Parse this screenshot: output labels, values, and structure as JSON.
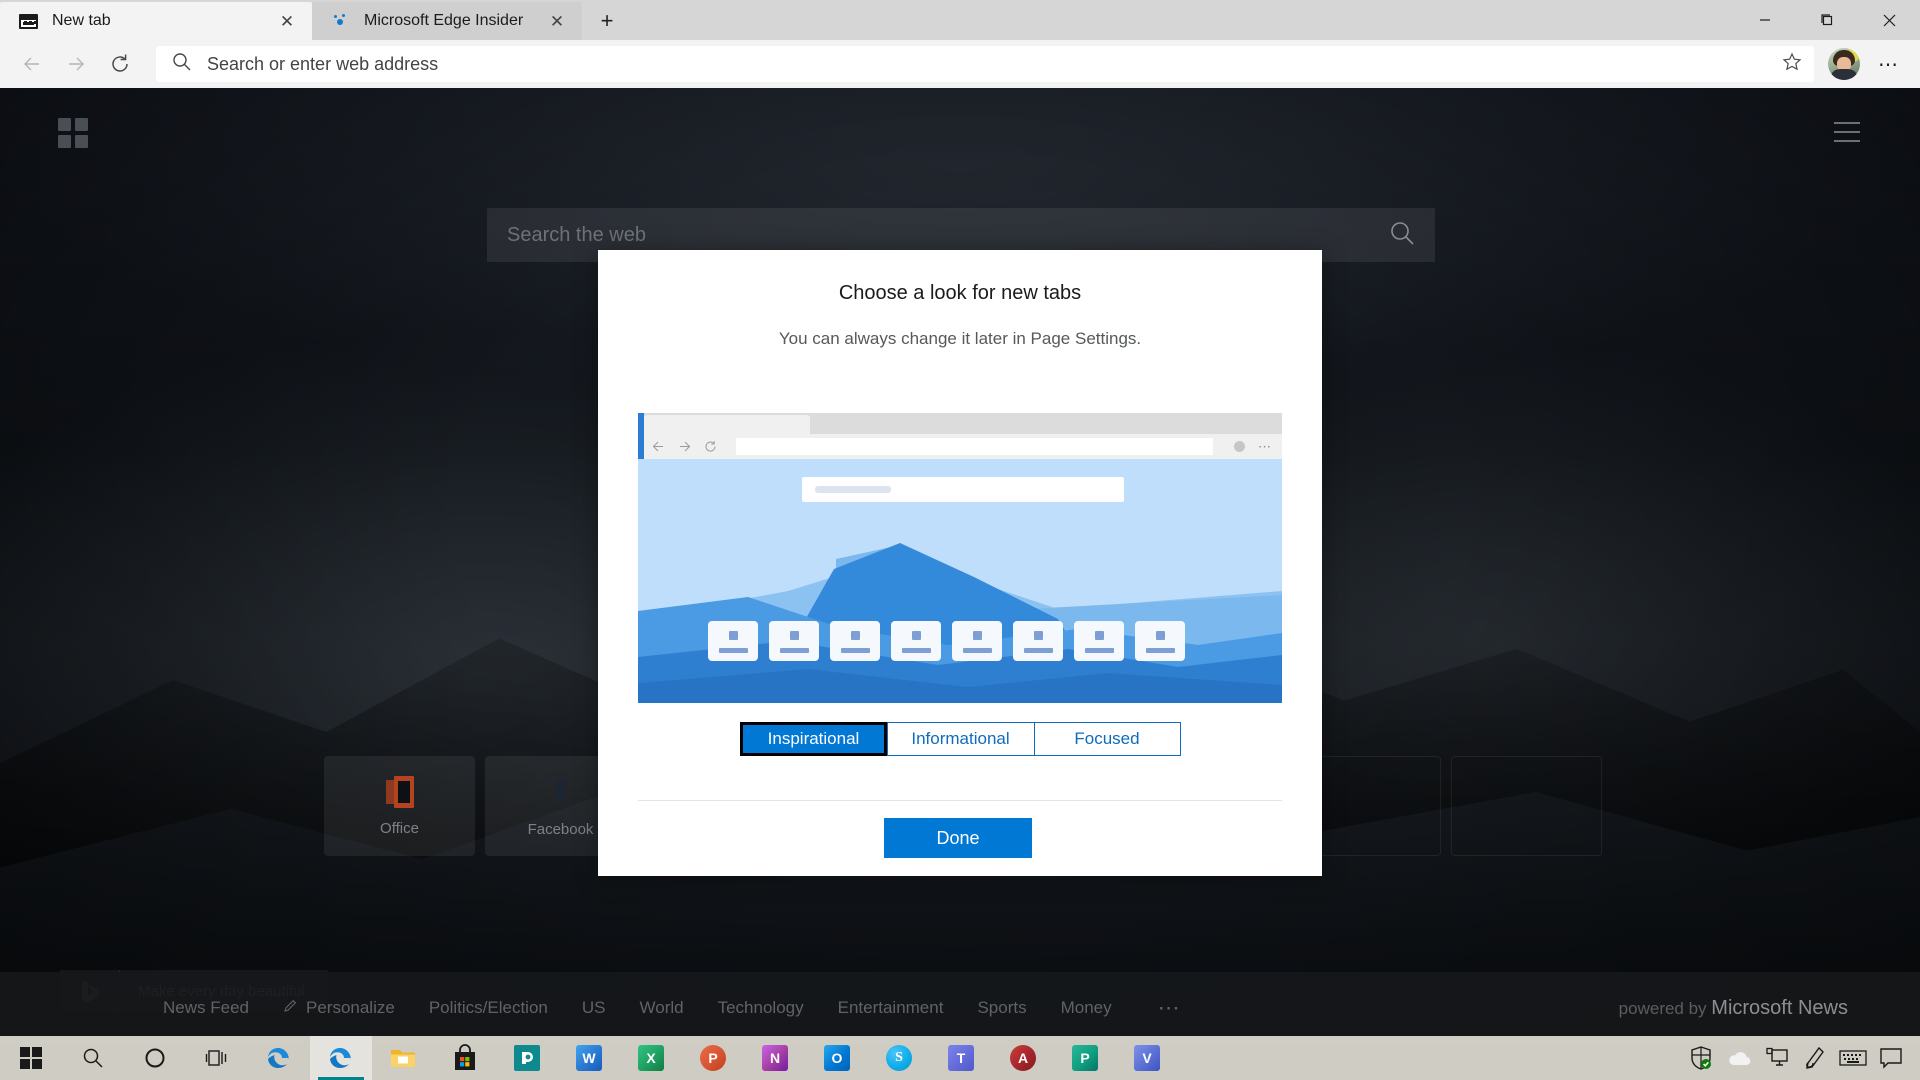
{
  "browser": {
    "tabs": [
      {
        "title": "New tab",
        "favicon": "newtab-icon",
        "active": true,
        "close_label": "✕"
      },
      {
        "title": "Microsoft Edge Insider",
        "favicon": "edge-insider-icon",
        "active": false,
        "close_label": "✕"
      }
    ],
    "new_tab_button": "+",
    "window_controls": {
      "minimize": "—",
      "restore": "❐",
      "close": "✕"
    },
    "toolbar": {
      "back": "back-arrow-icon",
      "forward": "forward-arrow-icon",
      "refresh": "refresh-icon",
      "omnibox_placeholder": "Search or enter web address",
      "favorite": "star-icon",
      "profile": "avatar",
      "settings_more": "⋯"
    }
  },
  "newtab": {
    "grid_icon": "app-grid-icon",
    "hamburger_icon": "hamburger-icon",
    "search_placeholder": "Search the web",
    "search_icon": "search-icon",
    "tiles": [
      {
        "label": "Office",
        "icon": "office-icon"
      },
      {
        "label": "Facebook",
        "icon": "facebook-icon"
      },
      {
        "label": "",
        "icon": ""
      },
      {
        "label": "",
        "icon": ""
      },
      {
        "label": "",
        "icon": ""
      },
      {
        "label": "",
        "icon": ""
      },
      {
        "label": "",
        "icon": ""
      },
      {
        "label": "",
        "icon": ""
      }
    ],
    "bing": {
      "logo": "bing-icon",
      "caption": "Make every day beautiful"
    },
    "news": {
      "links": [
        {
          "label": "News Feed",
          "icon": ""
        },
        {
          "label": "Personalize",
          "icon": "pencil-icon"
        },
        {
          "label": "Politics/Election",
          "icon": ""
        },
        {
          "label": "US",
          "icon": ""
        },
        {
          "label": "World",
          "icon": ""
        },
        {
          "label": "Technology",
          "icon": ""
        },
        {
          "label": "Entertainment",
          "icon": ""
        },
        {
          "label": "Sports",
          "icon": ""
        },
        {
          "label": "Money",
          "icon": ""
        }
      ],
      "more": "⋯",
      "powered_prefix": "powered by ",
      "powered_brand": "Microsoft News"
    }
  },
  "dialog": {
    "title": "Choose a look for new tabs",
    "subtitle": "You can always change it later in Page Settings.",
    "preview": {
      "alt": "inspirational-new-tab-preview",
      "tile_count": 8
    },
    "options": [
      {
        "label": "Inspirational",
        "selected": true
      },
      {
        "label": "Informational",
        "selected": false
      },
      {
        "label": "Focused",
        "selected": false
      }
    ],
    "done_label": "Done",
    "accent_color": "#0078d4",
    "link_color": "#0f6cbd"
  },
  "taskbar": {
    "start": "windows-start-icon",
    "items": [
      {
        "name": "search-icon",
        "label": ""
      },
      {
        "name": "cortana-icon",
        "label": ""
      },
      {
        "name": "task-view-icon",
        "label": ""
      },
      {
        "name": "edge-icon",
        "label": "",
        "active": false
      },
      {
        "name": "edge-insider-icon",
        "label": "",
        "active": true
      },
      {
        "name": "file-explorer-icon",
        "label": ""
      },
      {
        "name": "microsoft-store-icon",
        "label": ""
      },
      {
        "name": "power-bi-icon",
        "label": "P"
      },
      {
        "name": "word-icon",
        "label": "W"
      },
      {
        "name": "excel-icon",
        "label": "X"
      },
      {
        "name": "powerpoint-icon",
        "label": "P"
      },
      {
        "name": "onenote-icon",
        "label": "N"
      },
      {
        "name": "outlook-icon",
        "label": "O"
      },
      {
        "name": "skype-icon",
        "label": "S"
      },
      {
        "name": "teams-icon",
        "label": "T"
      },
      {
        "name": "access-icon",
        "label": "A"
      },
      {
        "name": "publisher-icon",
        "label": "P"
      },
      {
        "name": "visio-icon",
        "label": "V"
      }
    ],
    "tray": [
      {
        "name": "windows-defender-icon"
      },
      {
        "name": "onedrive-icon"
      },
      {
        "name": "display-icon"
      },
      {
        "name": "pen-icon"
      },
      {
        "name": "touch-keyboard-icon"
      },
      {
        "name": "action-center-icon"
      }
    ]
  }
}
